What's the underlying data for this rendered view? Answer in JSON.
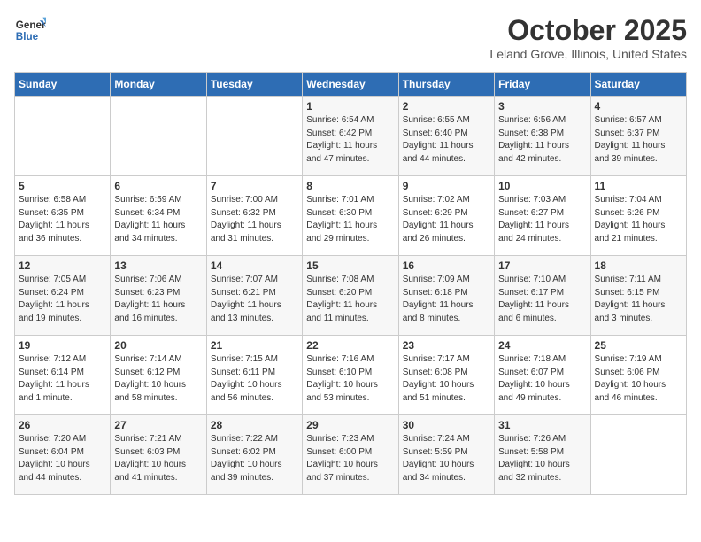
{
  "header": {
    "logo_line1": "General",
    "logo_line2": "Blue",
    "title": "October 2025",
    "subtitle": "Leland Grove, Illinois, United States"
  },
  "days_of_week": [
    "Sunday",
    "Monday",
    "Tuesday",
    "Wednesday",
    "Thursday",
    "Friday",
    "Saturday"
  ],
  "weeks": [
    [
      {
        "day": "",
        "info": ""
      },
      {
        "day": "",
        "info": ""
      },
      {
        "day": "",
        "info": ""
      },
      {
        "day": "1",
        "info": "Sunrise: 6:54 AM\nSunset: 6:42 PM\nDaylight: 11 hours\nand 47 minutes."
      },
      {
        "day": "2",
        "info": "Sunrise: 6:55 AM\nSunset: 6:40 PM\nDaylight: 11 hours\nand 44 minutes."
      },
      {
        "day": "3",
        "info": "Sunrise: 6:56 AM\nSunset: 6:38 PM\nDaylight: 11 hours\nand 42 minutes."
      },
      {
        "day": "4",
        "info": "Sunrise: 6:57 AM\nSunset: 6:37 PM\nDaylight: 11 hours\nand 39 minutes."
      }
    ],
    [
      {
        "day": "5",
        "info": "Sunrise: 6:58 AM\nSunset: 6:35 PM\nDaylight: 11 hours\nand 36 minutes."
      },
      {
        "day": "6",
        "info": "Sunrise: 6:59 AM\nSunset: 6:34 PM\nDaylight: 11 hours\nand 34 minutes."
      },
      {
        "day": "7",
        "info": "Sunrise: 7:00 AM\nSunset: 6:32 PM\nDaylight: 11 hours\nand 31 minutes."
      },
      {
        "day": "8",
        "info": "Sunrise: 7:01 AM\nSunset: 6:30 PM\nDaylight: 11 hours\nand 29 minutes."
      },
      {
        "day": "9",
        "info": "Sunrise: 7:02 AM\nSunset: 6:29 PM\nDaylight: 11 hours\nand 26 minutes."
      },
      {
        "day": "10",
        "info": "Sunrise: 7:03 AM\nSunset: 6:27 PM\nDaylight: 11 hours\nand 24 minutes."
      },
      {
        "day": "11",
        "info": "Sunrise: 7:04 AM\nSunset: 6:26 PM\nDaylight: 11 hours\nand 21 minutes."
      }
    ],
    [
      {
        "day": "12",
        "info": "Sunrise: 7:05 AM\nSunset: 6:24 PM\nDaylight: 11 hours\nand 19 minutes."
      },
      {
        "day": "13",
        "info": "Sunrise: 7:06 AM\nSunset: 6:23 PM\nDaylight: 11 hours\nand 16 minutes."
      },
      {
        "day": "14",
        "info": "Sunrise: 7:07 AM\nSunset: 6:21 PM\nDaylight: 11 hours\nand 13 minutes."
      },
      {
        "day": "15",
        "info": "Sunrise: 7:08 AM\nSunset: 6:20 PM\nDaylight: 11 hours\nand 11 minutes."
      },
      {
        "day": "16",
        "info": "Sunrise: 7:09 AM\nSunset: 6:18 PM\nDaylight: 11 hours\nand 8 minutes."
      },
      {
        "day": "17",
        "info": "Sunrise: 7:10 AM\nSunset: 6:17 PM\nDaylight: 11 hours\nand 6 minutes."
      },
      {
        "day": "18",
        "info": "Sunrise: 7:11 AM\nSunset: 6:15 PM\nDaylight: 11 hours\nand 3 minutes."
      }
    ],
    [
      {
        "day": "19",
        "info": "Sunrise: 7:12 AM\nSunset: 6:14 PM\nDaylight: 11 hours\nand 1 minute."
      },
      {
        "day": "20",
        "info": "Sunrise: 7:14 AM\nSunset: 6:12 PM\nDaylight: 10 hours\nand 58 minutes."
      },
      {
        "day": "21",
        "info": "Sunrise: 7:15 AM\nSunset: 6:11 PM\nDaylight: 10 hours\nand 56 minutes."
      },
      {
        "day": "22",
        "info": "Sunrise: 7:16 AM\nSunset: 6:10 PM\nDaylight: 10 hours\nand 53 minutes."
      },
      {
        "day": "23",
        "info": "Sunrise: 7:17 AM\nSunset: 6:08 PM\nDaylight: 10 hours\nand 51 minutes."
      },
      {
        "day": "24",
        "info": "Sunrise: 7:18 AM\nSunset: 6:07 PM\nDaylight: 10 hours\nand 49 minutes."
      },
      {
        "day": "25",
        "info": "Sunrise: 7:19 AM\nSunset: 6:06 PM\nDaylight: 10 hours\nand 46 minutes."
      }
    ],
    [
      {
        "day": "26",
        "info": "Sunrise: 7:20 AM\nSunset: 6:04 PM\nDaylight: 10 hours\nand 44 minutes."
      },
      {
        "day": "27",
        "info": "Sunrise: 7:21 AM\nSunset: 6:03 PM\nDaylight: 10 hours\nand 41 minutes."
      },
      {
        "day": "28",
        "info": "Sunrise: 7:22 AM\nSunset: 6:02 PM\nDaylight: 10 hours\nand 39 minutes."
      },
      {
        "day": "29",
        "info": "Sunrise: 7:23 AM\nSunset: 6:00 PM\nDaylight: 10 hours\nand 37 minutes."
      },
      {
        "day": "30",
        "info": "Sunrise: 7:24 AM\nSunset: 5:59 PM\nDaylight: 10 hours\nand 34 minutes."
      },
      {
        "day": "31",
        "info": "Sunrise: 7:26 AM\nSunset: 5:58 PM\nDaylight: 10 hours\nand 32 minutes."
      },
      {
        "day": "",
        "info": ""
      }
    ]
  ]
}
